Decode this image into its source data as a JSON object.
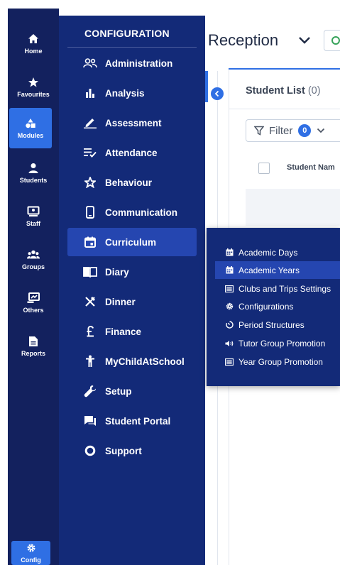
{
  "rail": {
    "items": [
      {
        "label": "Home",
        "icon": "home-icon"
      },
      {
        "label": "Favourites",
        "icon": "star-icon"
      },
      {
        "label": "Modules",
        "icon": "modules-icon"
      },
      {
        "label": "Students",
        "icon": "person-icon"
      },
      {
        "label": "Staff",
        "icon": "staff-icon"
      },
      {
        "label": "Groups",
        "icon": "groups-icon"
      },
      {
        "label": "Others",
        "icon": "others-icon"
      },
      {
        "label": "Reports",
        "icon": "document-icon"
      }
    ],
    "config_label": "Config"
  },
  "menu": {
    "title": "CONFIGURATION",
    "items": [
      {
        "label": "Administration",
        "icon": "people-icon"
      },
      {
        "label": "Analysis",
        "icon": "bar-chart-icon"
      },
      {
        "label": "Assessment",
        "icon": "pencil-icon"
      },
      {
        "label": "Attendance",
        "icon": "checklist-icon"
      },
      {
        "label": "Behaviour",
        "icon": "star-outline-icon"
      },
      {
        "label": "Communication",
        "icon": "phone-icon"
      },
      {
        "label": "Curriculum",
        "icon": "calendar-icon"
      },
      {
        "label": "Diary",
        "icon": "book-icon"
      },
      {
        "label": "Dinner",
        "icon": "cutlery-icon"
      },
      {
        "label": "Finance",
        "icon": "pound-icon"
      },
      {
        "label": "MyChildAtSchool",
        "icon": "child-icon"
      },
      {
        "label": "Setup",
        "icon": "wrench-icon"
      },
      {
        "label": "Student Portal",
        "icon": "chat-icon"
      },
      {
        "label": "Support",
        "icon": "ring-icon"
      }
    ]
  },
  "main": {
    "title": "Reception",
    "student_list_label": "Student List",
    "student_count": "(0)",
    "filter_label": "Filter",
    "filter_count": "0",
    "column_header": "Student Nam"
  },
  "flyout": {
    "items": [
      {
        "label": "Academic Days",
        "icon": "calendar-small-icon"
      },
      {
        "label": "Academic Years",
        "icon": "calendar-small-icon"
      },
      {
        "label": "Clubs and Trips Settings",
        "icon": "list-icon"
      },
      {
        "label": "Configurations",
        "icon": "gear-icon"
      },
      {
        "label": "Period Structures",
        "icon": "timer-icon"
      },
      {
        "label": "Tutor Group Promotion",
        "icon": "megaphone-icon"
      },
      {
        "label": "Year Group Promotion",
        "icon": "list-icon"
      }
    ]
  },
  "colors": {
    "rail_bg": "#13215e",
    "menu_bg": "#132a78",
    "active_bg": "#2546b0",
    "accent": "#2f6fe4"
  }
}
